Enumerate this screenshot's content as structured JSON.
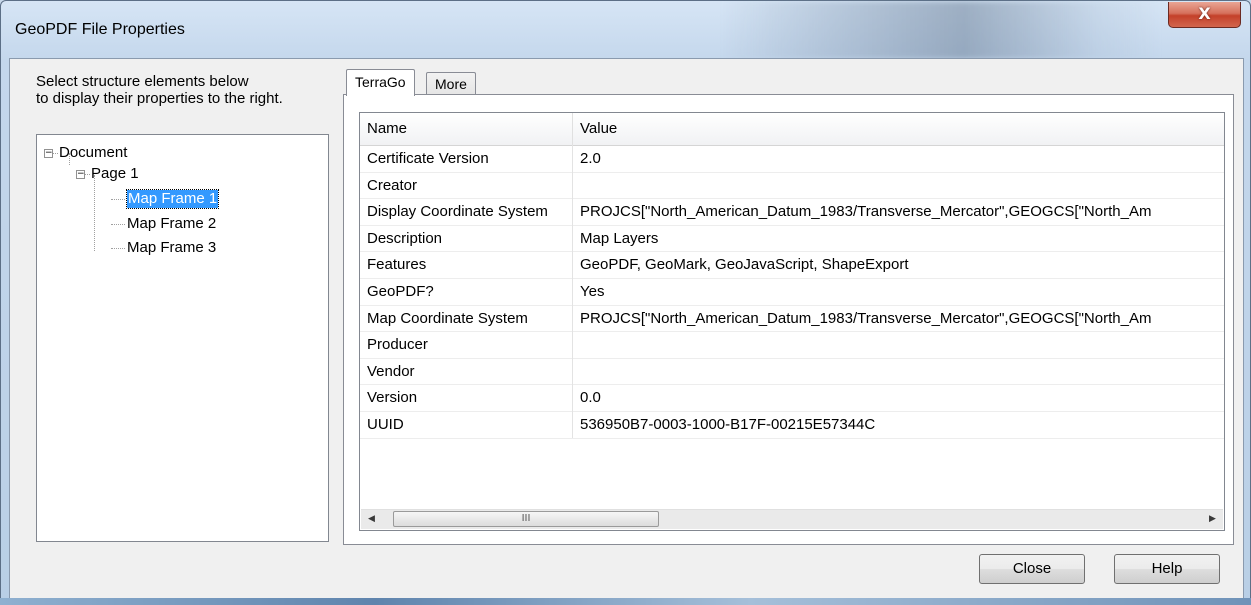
{
  "window": {
    "title": "GeoPDF File Properties",
    "close_glyph": "X"
  },
  "left": {
    "instructions": "Select structure elements below\nto display their properties to the right.",
    "tree": [
      {
        "label": "Document",
        "level": 0,
        "expander": "−",
        "selected": false
      },
      {
        "label": "Page 1",
        "level": 1,
        "expander": "−",
        "selected": false
      },
      {
        "label": "Map Frame 1",
        "level": 2,
        "selected": true
      },
      {
        "label": "Map Frame 2",
        "level": 2,
        "selected": false
      },
      {
        "label": "Map Frame 3",
        "level": 2,
        "selected": false
      }
    ]
  },
  "tabs": [
    {
      "label": "TerraGo",
      "active": true
    },
    {
      "label": "More",
      "active": false
    }
  ],
  "grid": {
    "headers": {
      "name": "Name",
      "value": "Value"
    },
    "rows": [
      {
        "name": "Certificate Version",
        "value": "2.0"
      },
      {
        "name": "Creator",
        "value": ""
      },
      {
        "name": "Display Coordinate System",
        "value": "PROJCS[\"North_American_Datum_1983/Transverse_Mercator\",GEOGCS[\"North_Am"
      },
      {
        "name": "Description",
        "value": "Map Layers"
      },
      {
        "name": "Features",
        "value": "GeoPDF, GeoMark, GeoJavaScript, ShapeExport"
      },
      {
        "name": "GeoPDF?",
        "value": "Yes"
      },
      {
        "name": "Map Coordinate System",
        "value": "PROJCS[\"North_American_Datum_1983/Transverse_Mercator\",GEOGCS[\"North_Am"
      },
      {
        "name": "Producer",
        "value": ""
      },
      {
        "name": "Vendor",
        "value": ""
      },
      {
        "name": "Version",
        "value": "0.0"
      },
      {
        "name": "UUID",
        "value": "536950B7-0003-1000-B17F-00215E57344C"
      }
    ],
    "scrollbar": {
      "left_arrow": "◀",
      "right_arrow": "▶",
      "thumb_grip": "III"
    }
  },
  "buttons": {
    "close": "Close",
    "help": "Help"
  }
}
